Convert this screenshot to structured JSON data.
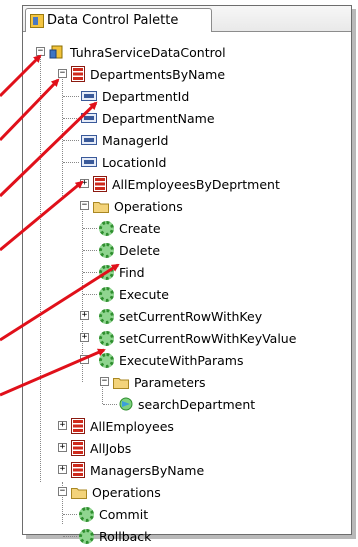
{
  "palette": {
    "tab_label": "Data Control Palette"
  },
  "tree": {
    "root": "TuhraServiceDataControl",
    "departments_by_name": "DepartmentsByName",
    "attrs": [
      "DepartmentId",
      "DepartmentName",
      "ManagerId",
      "LocationId"
    ],
    "all_emp_by_dept": "AllEmployeesByDeprtment",
    "operations": "Operations",
    "ops": [
      "Create",
      "Delete",
      "Find",
      "Execute",
      "setCurrentRowWithKey",
      "setCurrentRowWithKeyValue",
      "ExecuteWithParams"
    ],
    "parameters": "Parameters",
    "search_department": "searchDepartment",
    "all_employees": "AllEmployees",
    "all_jobs": "AllJobs",
    "managers_by_name": "ManagersByName",
    "operations2": "Operations",
    "ops2": [
      "Commit",
      "Rollback"
    ]
  },
  "colors": {
    "arrow": "#e0101a",
    "collection_icon": "#cf2a1c",
    "attr_icon": "#3a5a9a",
    "gear_icon": "#3aa33a",
    "folder_icon": "#f3d37a"
  }
}
